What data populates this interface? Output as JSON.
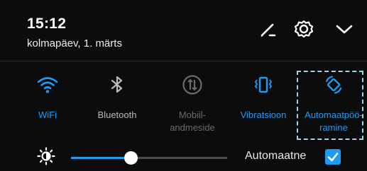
{
  "header": {
    "time": "15:12",
    "date": "kolmapäev, 1. märts",
    "icons": [
      "edit-icon",
      "gear-icon",
      "chevron-down-icon"
    ]
  },
  "toggles": [
    {
      "label": "WiFi",
      "state": "active",
      "icon": "wifi-icon"
    },
    {
      "label": "Bluetooth",
      "state": "inactive",
      "icon": "bluetooth-icon"
    },
    {
      "label": "Mobiil-\nandmeside",
      "state": "disabled",
      "icon": "mobile-data-icon"
    },
    {
      "label": "Vibratsioon",
      "state": "active",
      "icon": "vibrate-icon"
    },
    {
      "label": "Automaatpöö-\nramine",
      "state": "active",
      "icon": "auto-rotate-icon"
    }
  ],
  "brightness": {
    "level": 0.38,
    "auto_label": "Automaatne",
    "auto_checked": true
  },
  "colors": {
    "accent": "#1e9bf0",
    "background": "#0c0c0c",
    "highlight": "#9fd3ea"
  }
}
